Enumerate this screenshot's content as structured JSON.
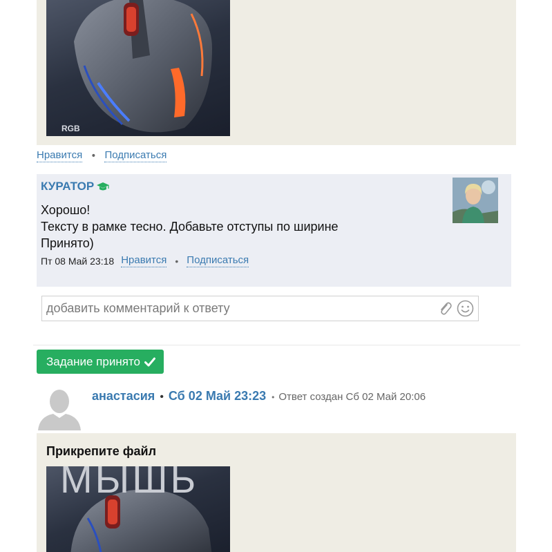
{
  "top_answer": {
    "image_label": "RGB"
  },
  "top_actions": {
    "like": "Нравится",
    "subscribe": "Подписаться"
  },
  "curator": {
    "name": "КУРАТОР",
    "role_icon": "graduation-cap-icon",
    "lines": [
      "Хорошо!",
      "Тексту в рамке тесно. Добавьте отступы по ширине",
      "Принято)"
    ],
    "date": "Пт 08 Май 23:18",
    "like": "Нравится",
    "subscribe": "Подписаться"
  },
  "comment": {
    "placeholder": "добавить комментарий к ответу",
    "attach_icon": "paperclip-icon",
    "emoji_icon": "smile-icon"
  },
  "status": {
    "label": "Задание принято",
    "icon": "check-icon",
    "color": "#27ae60"
  },
  "answer": {
    "user": "анастасия",
    "date": "Сб 02 Май 23:23",
    "created": "Ответ создан Сб 02 Май 20:06",
    "title": "Прикрепите файл",
    "image_text": "МЫШЬ"
  },
  "colors": {
    "link": "#3a7ab0",
    "answer_bg": "#efede4",
    "curator_bg": "#eceef4"
  }
}
